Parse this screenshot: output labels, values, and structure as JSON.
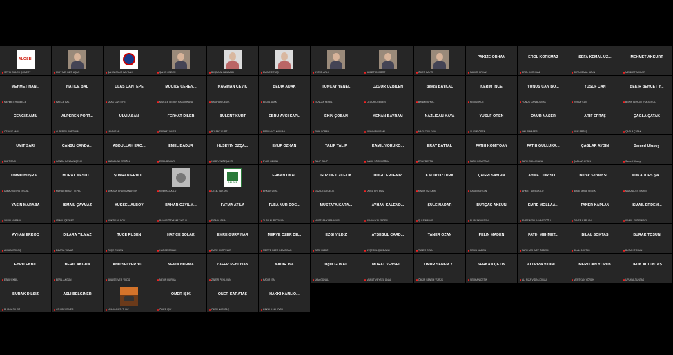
{
  "participants": [
    {
      "display": "",
      "label": "SEVGİ GÜLEŞ ÇÖMERT",
      "video": "logo",
      "logo_text": "ALOSBI"
    },
    {
      "display": "",
      "label": "ÜMİT MEHMET UÇAN",
      "video": "person"
    },
    {
      "display": "",
      "label": "ŞAHİN ONUR BAYRAK",
      "video": "badge"
    },
    {
      "display": "",
      "label": "ŞAHİN ÖNDER",
      "video": "person"
    },
    {
      "display": "",
      "label": "BÜŞRA AL BIRAMAN",
      "video": "portrait"
    },
    {
      "display": "",
      "label": "EMİNE ERTAŞ",
      "video": "portrait"
    },
    {
      "display": "",
      "label": "AYTUĞ ARLI",
      "video": "person"
    },
    {
      "display": "",
      "label": "AHMET CÖMERT",
      "video": "person"
    },
    {
      "display": "",
      "label": "ÖMER BAYIR",
      "video": "person"
    },
    {
      "display": "PAKİZE ORHAN",
      "label": "PAKİZE ORHAN"
    },
    {
      "display": "EROL KORKMAZ",
      "label": "EROL KORKMAZ"
    },
    {
      "display": "SEFA KEMAL UZ...",
      "label": "SEFA KEMAL UZUN"
    },
    {
      "display": "MEHMET AKKURT",
      "label": "MEHMET AKKURT"
    },
    {
      "display": "MEHMET HAN...",
      "label": "MEHMET HANBECE"
    },
    {
      "display": "HATİCE BAL",
      "label": "HATİCE BAL"
    },
    {
      "display": "ULAŞ CANTEPE",
      "label": "ULAŞ CANTEPE"
    },
    {
      "display": "MUCİZE CEREN...",
      "label": "MUCİZE CEREN HASÇIRKAYA"
    },
    {
      "display": "NAGİHAN ÇEVİK",
      "label": "NAGİHAN ÇEVİK"
    },
    {
      "display": "BEDİA ADAK",
      "label": "BEDİA ADAK"
    },
    {
      "display": "TUNCAY YENEL",
      "label": "TUNCAY YENEL"
    },
    {
      "display": "ÖZGÜR ÖZBİLEN",
      "label": "ÖZGÜR ÖZBİLEN"
    },
    {
      "display": "Beyza BAYKAL",
      "label": "Beyza BAYKAL"
    },
    {
      "display": "KERİM İNCE",
      "label": "KERİM İNCE"
    },
    {
      "display": "YUNUS CAN BO...",
      "label": "YUNUS CAN BOSNAK"
    },
    {
      "display": "YUSUF CAN",
      "label": "YUSUF CAN"
    },
    {
      "display": "BEKİR BEHÇET Y...",
      "label": "BEKİR BEHÇET YÜKSEKOL"
    },
    {
      "display": "CENGİZ AMİL",
      "label": "CENGİZ AMİL"
    },
    {
      "display": "ALPEREN PORT...",
      "label": "ALPEREN PORTAKAL"
    },
    {
      "display": "ULVİ ASAN",
      "label": "ULVİ ASAN"
    },
    {
      "display": "FERHAT DİLER",
      "label": "FERHAT DİLER"
    },
    {
      "display": "BÜLENT KURT",
      "label": "BÜLENT KURT"
    },
    {
      "display": "EBRU AVCI KAP...",
      "label": "EBRU AVCI KAPLAN"
    },
    {
      "display": "EKİN ÇOBAN",
      "label": "EKİN ÇOBAN"
    },
    {
      "display": "KENAN BAYRAM",
      "label": "KENAN BAYRAM"
    },
    {
      "display": "NAZLICAN KAYA",
      "label": "NAZLICAN KAYA"
    },
    {
      "display": "YUSUF ÖREN",
      "label": "YUSUF ÖREN"
    },
    {
      "display": "ONUR NASER",
      "label": "ONUR NASER"
    },
    {
      "display": "ARİF ERTAŞ",
      "label": "ARİF ERTAŞ"
    },
    {
      "display": "ÇAĞLA ÇATAK",
      "label": "ÇAĞLA ÇATAK"
    },
    {
      "display": "ÜMİT SARI",
      "label": "ÜMİT SARI"
    },
    {
      "display": "CANSU CANDA...",
      "label": "CANSU CANDAN ÇELİK"
    },
    {
      "display": "ABDULLAH ERO...",
      "label": "ABDULLAH EROĞLU"
    },
    {
      "display": "EMEL BADUR",
      "label": "EMEL BADUR"
    },
    {
      "display": "HÜSEYİN ÖZÇA...",
      "label": "HÜSEYİN ÖZÇAKIR"
    },
    {
      "display": "EYÜP ÖZKAN",
      "label": "EYÜP ÖZKAN"
    },
    {
      "display": "TALİP TALİP",
      "label": "TALİP TALİP"
    },
    {
      "display": "KAMİL YÖRÜKO...",
      "label": "KAMİL YÖRÜKOĞLU"
    },
    {
      "display": "ERAY BATTAL",
      "label": "ERAY BATTAL"
    },
    {
      "display": "FATİH KOMİTOAN",
      "label": "FATİH KOMİTOAN"
    },
    {
      "display": "FATİH GÜLLÜKA...",
      "label": "FATİH GÜLLÜKAYA"
    },
    {
      "display": "ÇAĞLAR AYDIN",
      "label": "ÇAĞLAR AYDIN"
    },
    {
      "display": "Samed Ulusoy",
      "label": "Samed Ulusoy"
    },
    {
      "display": "ÜMMÜ BÜŞRA...",
      "label": "ÜMMÜ BÜŞRA ERÇAK"
    },
    {
      "display": "MURAT MESUT...",
      "label": "MURAT MESUT TEPELİ"
    },
    {
      "display": "ŞÜKRAN ERDO...",
      "label": "ŞÜKRAN ERDOĞAN AYSIN"
    },
    {
      "display": "",
      "label": "KÜBRA GÜÇLÜ",
      "video": "cat"
    },
    {
      "display": "",
      "label": "ÇELİK TÜKTAŞ",
      "video": "graphic",
      "logo_text": "SALOSS"
    },
    {
      "display": "ERKAN ÜNAL",
      "label": "ERKAN ÜNAL"
    },
    {
      "display": "GÜZİDE ÖZÇELİK",
      "label": "GÜZİDE ÖZÇELİK"
    },
    {
      "display": "DOĞU ERTEMİZ",
      "label": "DOĞU ERTEMİZ"
    },
    {
      "display": "KADİR ÖZTÜRK",
      "label": "KADİR ÖZTÜRK"
    },
    {
      "display": "ÇAĞRI SAYGIN",
      "label": "ÇAĞRI SAYGIN"
    },
    {
      "display": "AHMET İDRİSO...",
      "label": "AHMET İDRİSOĞLU"
    },
    {
      "display": "Burak Serdar Sİ...",
      "label": "Burak Serdar SELEK"
    },
    {
      "display": "MUKADDES ŞA...",
      "label": "MUKADDES ŞAHİN"
    },
    {
      "display": "YASİN MARABA",
      "label": "YASİN MARABA"
    },
    {
      "display": "İSMAİL ÇAYMAZ",
      "label": "İSMAİL ÇAYMAZ"
    },
    {
      "display": "YÜKSEL ALBOY",
      "label": "YÜKSEL ALBOY"
    },
    {
      "display": "BAHAR ÖZYILM...",
      "label": "BAHAR ÖZYILMAZ KOLLU"
    },
    {
      "display": "FATMA ATİLA",
      "label": "FATMA ATİLA"
    },
    {
      "display": "TUBA NUR DOĞ...",
      "label": "TUBA NUR DOĞAN"
    },
    {
      "display": "MUSTAFA KARA...",
      "label": "MUSTAFA KARABAYIR"
    },
    {
      "display": "AYHAN KALEND...",
      "label": "AYHAN KALENDER"
    },
    {
      "display": "ŞULE NADAR",
      "label": "ŞULE NADAR"
    },
    {
      "display": "BURÇAK AKSÜN",
      "label": "BURÇAK AKSÜN"
    },
    {
      "display": "EMRE MOLLAA...",
      "label": "EMRE MOLLAAHMETOĞLU"
    },
    {
      "display": "TANER KAPLAN",
      "label": "TANER KAPLAN"
    },
    {
      "display": "İSMAİL ERDEM...",
      "label": "İSMAİL ERDEMİRCİ"
    },
    {
      "display": "AYHAN ERKOÇ",
      "label": "AYHAN ERKOÇ"
    },
    {
      "display": "DİLARA YILMAZ",
      "label": "DİLARA YILMAZ"
    },
    {
      "display": "TUÇE RUŞEN",
      "label": "TUÇE RUŞEN"
    },
    {
      "display": "HATİCE SOLAK",
      "label": "HATİCE SOLAK"
    },
    {
      "display": "EMRE GÜRPINAR",
      "label": "EMRE GÜRPINAR"
    },
    {
      "display": "MERVE ÖZER DE...",
      "label": "MERVE ÖZER DEMİRDAĞ"
    },
    {
      "display": "EZGİ YILDIZ",
      "label": "EZGİ YILDIZ"
    },
    {
      "display": "AYŞEGÜL ÇARD...",
      "label": "AYŞEGÜL ÇARDAKLI"
    },
    {
      "display": "TANER OZAN",
      "label": "TANER OZAN"
    },
    {
      "display": "PELİN MADEN",
      "label": "PELİN MADEN"
    },
    {
      "display": "FATİH MEHMET...",
      "label": "FATİH MEHMET ÖZBERK"
    },
    {
      "display": "BİLAL SOKTAŞ",
      "label": "BİLAL SOKTAŞ"
    },
    {
      "display": "BURAK TOSUN",
      "label": "BURAK TOSUN"
    },
    {
      "display": "EBRU EKBİL",
      "label": "EBRU EKBİL"
    },
    {
      "display": "BERİL AKGÜN",
      "label": "BERİL AKGÜN"
    },
    {
      "display": "AHU SELVER YÜ...",
      "label": "AHU SELVER YILDIZ"
    },
    {
      "display": "NEVİN HURMA",
      "label": "NEVİN HURMA"
    },
    {
      "display": "ZAFER PEHLİVAN",
      "label": "ZAFER PEHLİVAN"
    },
    {
      "display": "KADİR İSA",
      "label": "KADİR İSA"
    },
    {
      "display": "Uğur GÜNAL",
      "label": "Uğur GÜNAL"
    },
    {
      "display": "MURAT VEYSEL...",
      "label": "MURAT VEYSEL ÜNAL"
    },
    {
      "display": "ÖMÜR SENEM Y...",
      "label": "ÖMÜR SENEM YÜRÜK"
    },
    {
      "display": "SERKAN ÇETİN",
      "label": "SERKAN ÇETİN"
    },
    {
      "display": "ALİ RIZA VİDİNL...",
      "label": "ALİ RIZA VİDİNLİOĞLU"
    },
    {
      "display": "MERTCAN YÖRÜK",
      "label": "MERTCAN YÖRÜK"
    },
    {
      "display": "UFUK ALTUNTAŞ",
      "label": "UFUK ALTUNTAŞ"
    },
    {
      "display": "BURAK DİLSİZ",
      "label": "BURAK DİLSİZ"
    },
    {
      "display": "ASLI BELGİNER",
      "label": "ASLI BELGİNER"
    },
    {
      "display": "",
      "label": "MUHAMMED TUNÇ",
      "video": "landscape"
    },
    {
      "display": "ÖMER IŞIK",
      "label": "ÖMER IŞIK"
    },
    {
      "display": "ONER KARATAŞ",
      "label": "ONER KARATAŞ"
    },
    {
      "display": "HAKKI KANLIO...",
      "label": "HAKKI KANLIOĞLU"
    }
  ],
  "colors": {
    "background": "#000000",
    "tile": "#262626",
    "name": "#ffffff",
    "muted_mic": "#e22222"
  }
}
